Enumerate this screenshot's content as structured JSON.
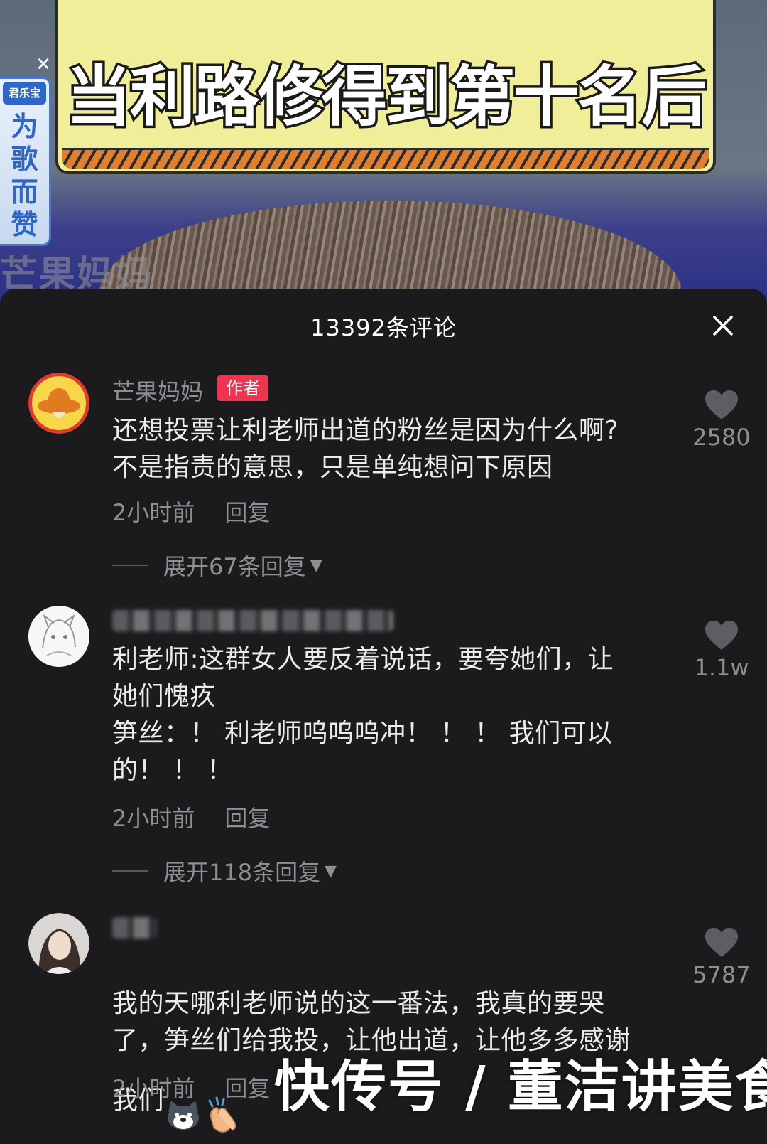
{
  "video": {
    "headline": "当利路修得到第十名后",
    "ad": {
      "brand": "君乐宝",
      "slogan": "为歌而赞"
    },
    "channel_watermark": "芒果妈妈"
  },
  "comments_sheet": {
    "title": "13392条评论",
    "close_icon": "close-icon"
  },
  "comments": [
    {
      "nickname": "芒果妈妈",
      "badge": "作者",
      "text": "还想投票让利老师出道的粉丝是因为什么啊?\n不是指责的意思，只是单纯想问下原因",
      "time": "2小时前",
      "reply_label": "回复",
      "likes": "2580",
      "expand_label": "展开67条回复"
    },
    {
      "nickname": "",
      "text": "利老师:这群女人要反着说话，要夸她们，让\n她们愧疚\n笋丝：！ 利老师呜呜呜冲！ ！ ！ 我们可以\n的！ ！ ！",
      "time": "2小时前",
      "reply_label": "回复",
      "likes": "1.1w",
      "expand_label": "展开118条回复"
    },
    {
      "nickname": "",
      "text": "我的天哪利老师说的这一番法，我真的要哭\n了，笋丝们给我投，让他出道，让他多多感谢\n我们",
      "time": "2小时前",
      "reply_label": "回复",
      "likes": "5787",
      "emojis": [
        "dog-emoji",
        "clapping-hands-emoji"
      ]
    }
  ],
  "footer_watermark": "快传号 / 董洁讲美食",
  "colors": {
    "sheet_bg": "#1b1b1d",
    "author_badge": "#f0334f",
    "secondary_text": "#8e8e93",
    "headline_card": "#f1ee9a"
  }
}
